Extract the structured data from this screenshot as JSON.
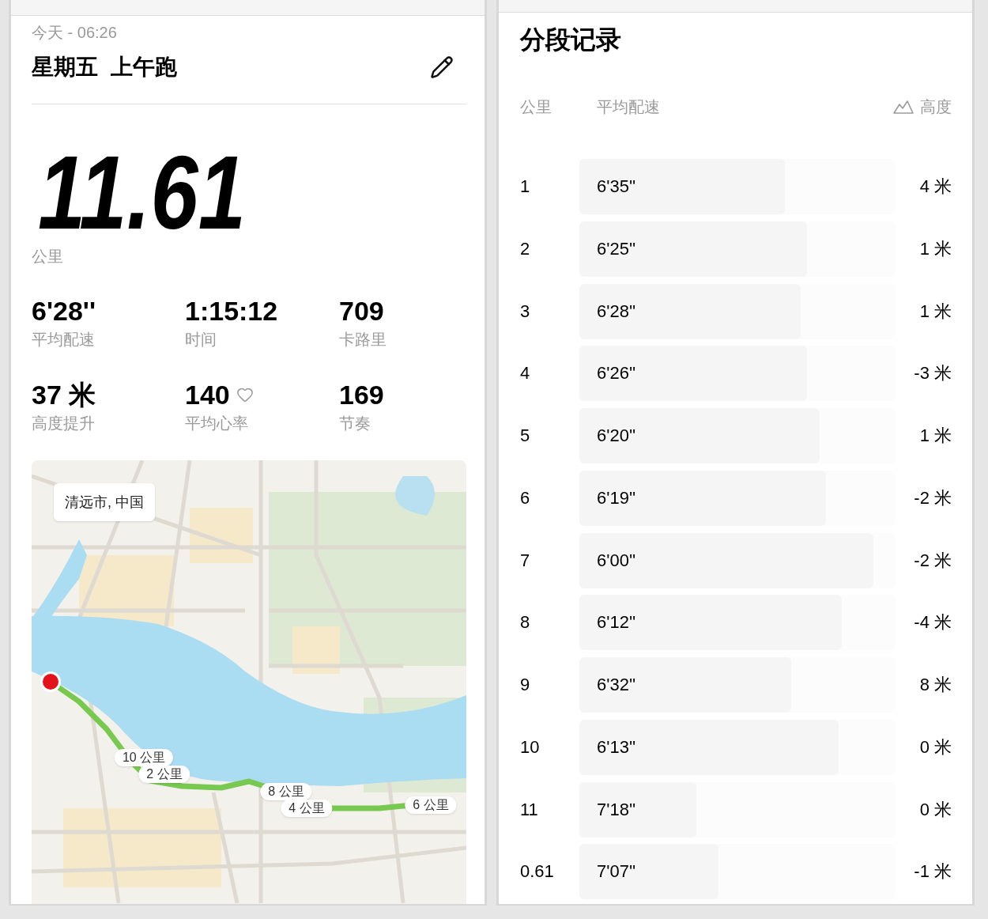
{
  "activity": {
    "date": "今天 - 06:26",
    "title": "星期五  上午跑"
  },
  "distance": {
    "value": "11.61",
    "unit": "公里"
  },
  "stats": [
    {
      "value": "6'28''",
      "label": "平均配速",
      "kind": "plain"
    },
    {
      "value": "1:15:12",
      "label": "时间",
      "kind": "plain"
    },
    {
      "value": "709",
      "label": "卡路里",
      "kind": "plain"
    },
    {
      "value": "37 米",
      "label": "高度提升",
      "kind": "plain"
    },
    {
      "value": "140",
      "label": "平均心率",
      "kind": "heart"
    },
    {
      "value": "169",
      "label": "节奏",
      "kind": "plain"
    }
  ],
  "map": {
    "location": "清远市, 中国",
    "markers": [
      "10 公里",
      "2 公里",
      "8 公里",
      "4 公里",
      "6 公里"
    ]
  },
  "splits": {
    "title": "分段记录",
    "columns": [
      "公里",
      "平均配速",
      "高度"
    ],
    "rows": [
      {
        "km": "1",
        "pace": "6'35''",
        "level": 0.65,
        "elevation": "4 米"
      },
      {
        "km": "2",
        "pace": "6'25''",
        "level": 0.72,
        "elevation": "1 米"
      },
      {
        "km": "3",
        "pace": "6'28''",
        "level": 0.7,
        "elevation": "1 米"
      },
      {
        "km": "4",
        "pace": "6'26''",
        "level": 0.72,
        "elevation": "-3 米"
      },
      {
        "km": "5",
        "pace": "6'20''",
        "level": 0.76,
        "elevation": "1 米"
      },
      {
        "km": "6",
        "pace": "6'19''",
        "level": 0.78,
        "elevation": "-2 米"
      },
      {
        "km": "7",
        "pace": "6'00''",
        "level": 0.93,
        "elevation": "-2 米"
      },
      {
        "km": "8",
        "pace": "6'12''",
        "level": 0.83,
        "elevation": "-4 米"
      },
      {
        "km": "9",
        "pace": "6'32''",
        "level": 0.67,
        "elevation": "8 米"
      },
      {
        "km": "10",
        "pace": "6'13''",
        "level": 0.82,
        "elevation": "0 米"
      },
      {
        "km": "11",
        "pace": "7'18''",
        "level": 0.37,
        "elevation": "0 米"
      },
      {
        "km": "0.61",
        "pace": "7'07''",
        "level": 0.44,
        "elevation": "-1 米"
      }
    ]
  }
}
